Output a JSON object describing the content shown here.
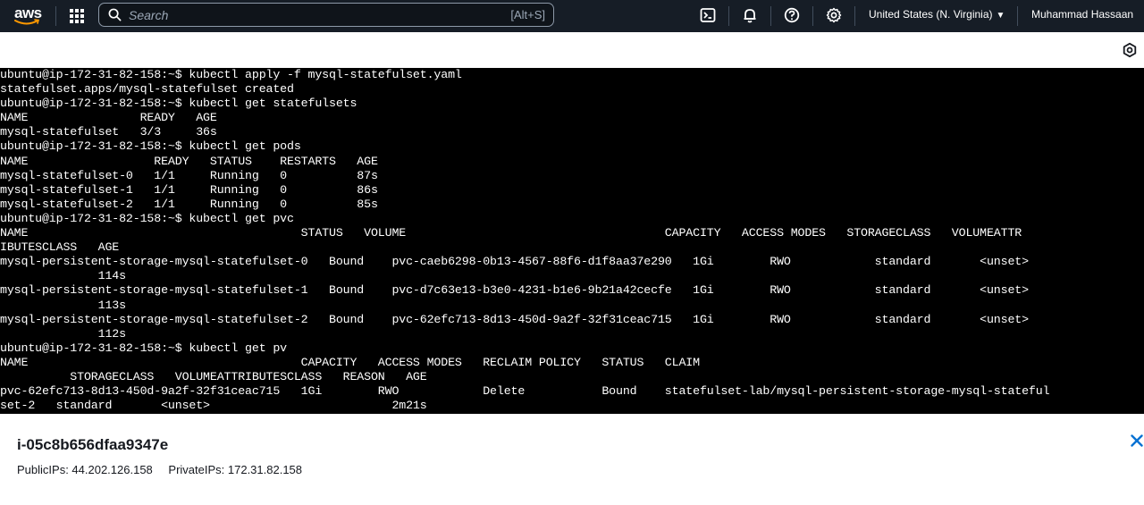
{
  "nav": {
    "logo": "aws",
    "search_placeholder": "Search",
    "search_shortcut": "[Alt+S]",
    "region": "United States (N. Virginia)",
    "user": "Muhammad Hassaan",
    "icons": [
      "cloudshell-icon",
      "bell-icon",
      "help-icon",
      "gear-icon"
    ]
  },
  "terminal": {
    "lines": [
      "ubuntu@ip-172-31-82-158:~$ kubectl apply -f mysql-statefulset.yaml",
      "statefulset.apps/mysql-statefulset created",
      "ubuntu@ip-172-31-82-158:~$ kubectl get statefulsets",
      "NAME                READY   AGE",
      "mysql-statefulset   3/3     36s",
      "ubuntu@ip-172-31-82-158:~$ kubectl get pods",
      "NAME                  READY   STATUS    RESTARTS   AGE",
      "mysql-statefulset-0   1/1     Running   0          87s",
      "mysql-statefulset-1   1/1     Running   0          86s",
      "mysql-statefulset-2   1/1     Running   0          85s",
      "ubuntu@ip-172-31-82-158:~$ kubectl get pvc",
      "NAME                                       STATUS   VOLUME                                     CAPACITY   ACCESS MODES   STORAGECLASS   VOLUMEATTR",
      "IBUTESCLASS   AGE",
      "mysql-persistent-storage-mysql-statefulset-0   Bound    pvc-caeb6298-0b13-4567-88f6-d1f8aa37e290   1Gi        RWO            standard       <unset>",
      "              114s",
      "mysql-persistent-storage-mysql-statefulset-1   Bound    pvc-d7c63e13-b3e0-4231-b1e6-9b21a42cecfe   1Gi        RWO            standard       <unset>",
      "              113s",
      "mysql-persistent-storage-mysql-statefulset-2   Bound    pvc-62efc713-8d13-450d-9a2f-32f31ceac715   1Gi        RWO            standard       <unset>",
      "              112s",
      "ubuntu@ip-172-31-82-158:~$ kubectl get pv",
      "NAME                                       CAPACITY   ACCESS MODES   RECLAIM POLICY   STATUS   CLAIM",
      "          STORAGECLASS   VOLUMEATTRIBUTESCLASS   REASON   AGE",
      "pvc-62efc713-8d13-450d-9a2f-32f31ceac715   1Gi        RWO            Delete           Bound    statefulset-lab/mysql-persistent-storage-mysql-stateful",
      "set-2   standard       <unset>                          2m21s"
    ]
  },
  "instance": {
    "id": "i-05c8b656dfaa9347e",
    "public_ips": "PublicIPs: 44.202.126.158",
    "private_ips": "PrivateIPs: 172.31.82.158"
  },
  "colors": {
    "nav_bg": "#161d26",
    "terminal_bg": "#000000",
    "terminal_fg": "#ffffff",
    "close_blue": "#0972d3"
  }
}
